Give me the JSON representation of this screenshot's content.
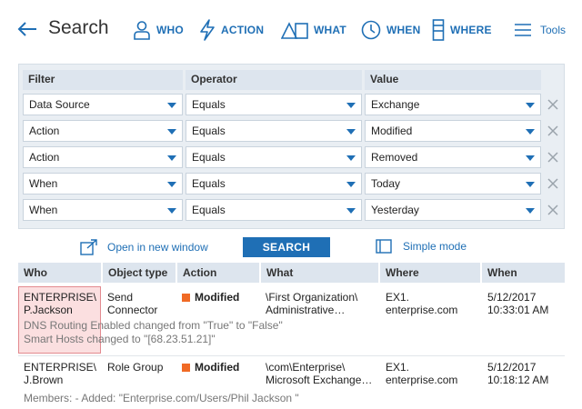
{
  "header": {
    "title": "Search",
    "nav": [
      {
        "key": "who",
        "label": "WHO",
        "icon": "person-icon"
      },
      {
        "key": "action",
        "label": "ACTION",
        "icon": "lightning-icon"
      },
      {
        "key": "what",
        "label": "WHAT",
        "icon": "shapes-icon"
      },
      {
        "key": "when",
        "label": "WHEN",
        "icon": "clock-icon"
      },
      {
        "key": "where",
        "label": "WHERE",
        "icon": "server-icon"
      }
    ],
    "tools_label": "Tools"
  },
  "filters": {
    "headers": {
      "filter": "Filter",
      "operator": "Operator",
      "value": "Value"
    },
    "rows": [
      {
        "filter": "Data Source",
        "operator": "Equals",
        "value": "Exchange"
      },
      {
        "filter": "Action",
        "operator": "Equals",
        "value": "Modified"
      },
      {
        "filter": "Action",
        "operator": "Equals",
        "value": "Removed"
      },
      {
        "filter": "When",
        "operator": "Equals",
        "value": "Today"
      },
      {
        "filter": "When",
        "operator": "Equals",
        "value": "Yesterday"
      }
    ]
  },
  "actions": {
    "open_window": "Open in new window",
    "search": "SEARCH",
    "simple_mode": "Simple mode"
  },
  "results": {
    "columns": [
      "Who",
      "Object type",
      "Action",
      "What",
      "Where",
      "When"
    ],
    "rows": [
      {
        "who": [
          "ENTERPRISE\\",
          "P.Jackson"
        ],
        "object_type": [
          "Send",
          "Connector"
        ],
        "action": "Modified",
        "what": [
          "\\First Organization\\",
          "Administrative…"
        ],
        "where": [
          "EX1.",
          "enterprise.com"
        ],
        "when": [
          "5/12/2017",
          "10:33:01 AM"
        ],
        "details": [
          "DNS Routing Enabled changed from \"True\" to \"False\"",
          "Smart Hosts changed to \"[68.23.51.21]\""
        ]
      },
      {
        "who": [
          "ENTERPRISE\\",
          "J.Brown"
        ],
        "object_type": [
          "Role Group"
        ],
        "action": "Modified",
        "what": [
          "\\com\\Enterprise\\",
          "Microsoft Exchange…"
        ],
        "where": [
          "EX1.",
          "enterprise.com"
        ],
        "when": [
          "5/12/2017",
          "10:18:12 AM"
        ],
        "details": [
          "Members: - Added: \"Enterprise.com/Users/Phil Jackson \""
        ]
      }
    ]
  },
  "colors": {
    "accent": "#1f6fb5",
    "modified_marker": "#f06a25",
    "highlight_fill": "#fbdfe0",
    "highlight_border": "#e38a8f"
  }
}
